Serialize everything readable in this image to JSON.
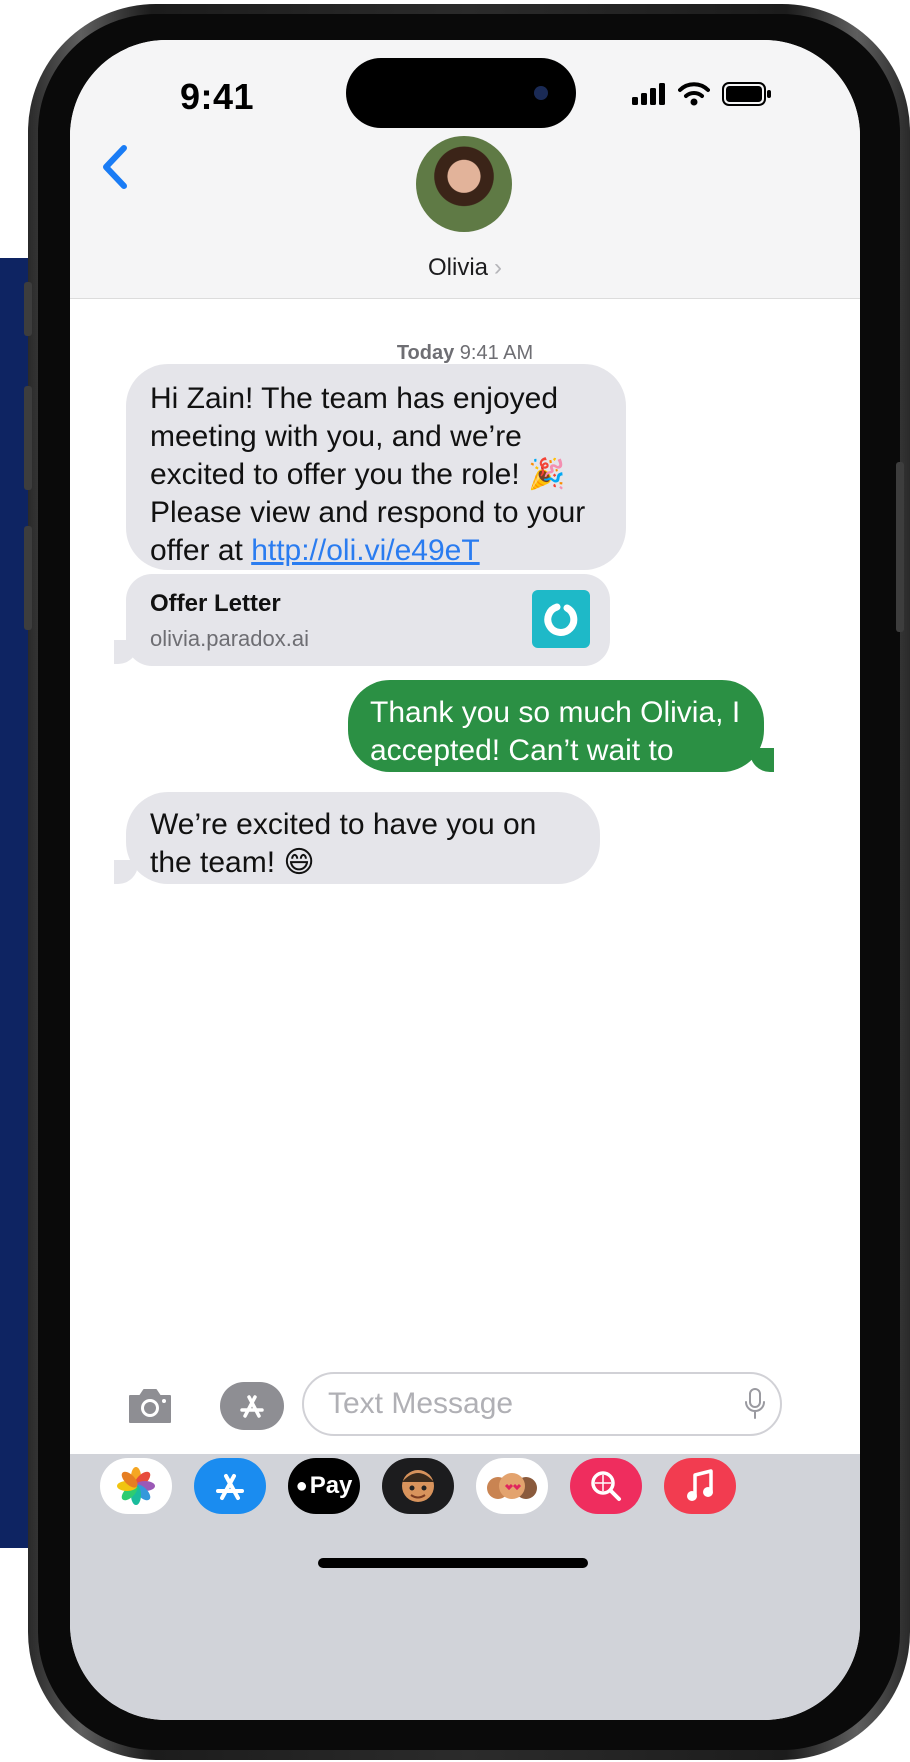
{
  "status_bar": {
    "time": "9:41"
  },
  "header": {
    "contact_name": "Olivia",
    "name_chevron": "›"
  },
  "thread": {
    "timestamp_day": "Today",
    "timestamp_time": "9:41 AM",
    "messages": [
      {
        "direction": "incoming",
        "text": "Hi Zain! The team has enjoyed meeting with you, and we’re excited to offer you the role! 🎉 Please view and respond to your offer at ",
        "link": "http://oli.vi/e49eT"
      },
      {
        "direction": "outgoing",
        "text": "Thank you so much Olivia, I accepted! Can’t wait to start!"
      },
      {
        "direction": "incoming",
        "text": "We’re excited to have you on the team! 😄"
      }
    ],
    "link_preview": {
      "title": "Offer Letter",
      "domain": "olivia.paradox.ai"
    }
  },
  "composer": {
    "placeholder": "Text Message"
  },
  "app_tray": {
    "items": [
      {
        "name": "photos-app-icon",
        "label": ""
      },
      {
        "name": "app-store-icon",
        "label": ""
      },
      {
        "name": "apple-pay-icon",
        "label": "Pay"
      },
      {
        "name": "memoji-icon",
        "label": ""
      },
      {
        "name": "memoji-stickers-icon",
        "label": ""
      },
      {
        "name": "image-search-icon",
        "label": ""
      },
      {
        "name": "music-icon",
        "label": ""
      }
    ]
  },
  "colors": {
    "outgoing_bubble": "#2b9044",
    "incoming_bubble": "#e5e5ea",
    "link": "#2a7cf0",
    "accent": "#007aff",
    "backdrop": "#0e2462"
  }
}
